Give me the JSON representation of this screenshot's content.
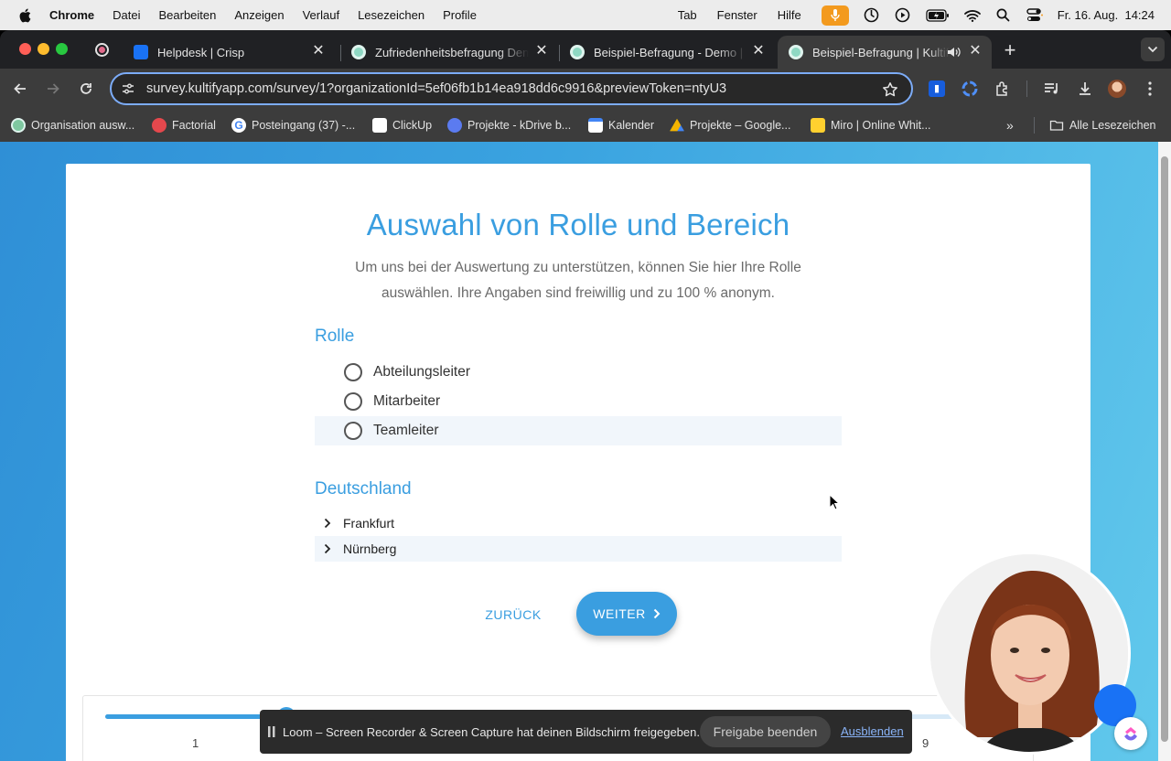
{
  "menubar": {
    "app": "Chrome",
    "items": [
      "Datei",
      "Bearbeiten",
      "Anzeigen",
      "Verlauf",
      "Lesezeichen",
      "Profile"
    ],
    "right_items": [
      "Tab",
      "Fenster",
      "Hilfe"
    ],
    "clock": "Fr. 16. Aug.  14:24"
  },
  "tabs": [
    {
      "title": "Helpdesk | Crisp",
      "active": false
    },
    {
      "title": "Zufriedenheitsbefragung Dem",
      "active": false
    },
    {
      "title": "Beispiel-Befragung - Demo | K",
      "active": false
    },
    {
      "title": "Beispiel-Befragung | Kultif",
      "active": true
    }
  ],
  "address_bar": {
    "url": "survey.kultifyapp.com/survey/1?organizationId=5ef06fb1b14ea918dd6c9916&previewToken=ntyU3"
  },
  "bookmarks": [
    {
      "label": "Organisation ausw...",
      "color": "#7ec8a0"
    },
    {
      "label": "Factorial",
      "color": "#e5484d"
    },
    {
      "label": "Posteingang (37) -...",
      "color": "#ffffff"
    },
    {
      "label": "ClickUp",
      "color": "#ffffff"
    },
    {
      "label": "Projekte - kDrive b...",
      "color": "#5b7bf0"
    },
    {
      "label": "Kalender",
      "color": "#4285f4"
    },
    {
      "label": "Projekte – Google...",
      "color": "#f4b400"
    },
    {
      "label": "Miro | Online Whit...",
      "color": "#ffd02f"
    }
  ],
  "bookmarks_all": "Alle Lesezeichen",
  "survey": {
    "title": "Auswahl von Rolle und Bereich",
    "intro": "Um uns bei der Auswertung zu unterstützen, können Sie hier Ihre Rolle auswählen. Ihre Angaben sind freiwillig und zu 100 % anonym.",
    "role_section": "Rolle",
    "roles": [
      "Abteilungsleiter",
      "Mitarbeiter",
      "Teamleiter"
    ],
    "area_section": "Deutschland",
    "areas": [
      "Frankfurt",
      "Nürnberg"
    ],
    "back_label": "ZURÜCK",
    "next_label": "WEITER",
    "progress": {
      "first_step": "1",
      "last_step": "9",
      "fraction": 0.2
    }
  },
  "loom": {
    "text": "Loom – Screen Recorder & Screen Capture hat deinen Bildschirm freigegeben.",
    "stop_label": "Freigabe beenden",
    "hide_label": "Ausblenden"
  },
  "colors": {
    "accent": "#3a9ee0",
    "chrome_dark": "#202124",
    "toolbar": "#3c3c3c"
  }
}
